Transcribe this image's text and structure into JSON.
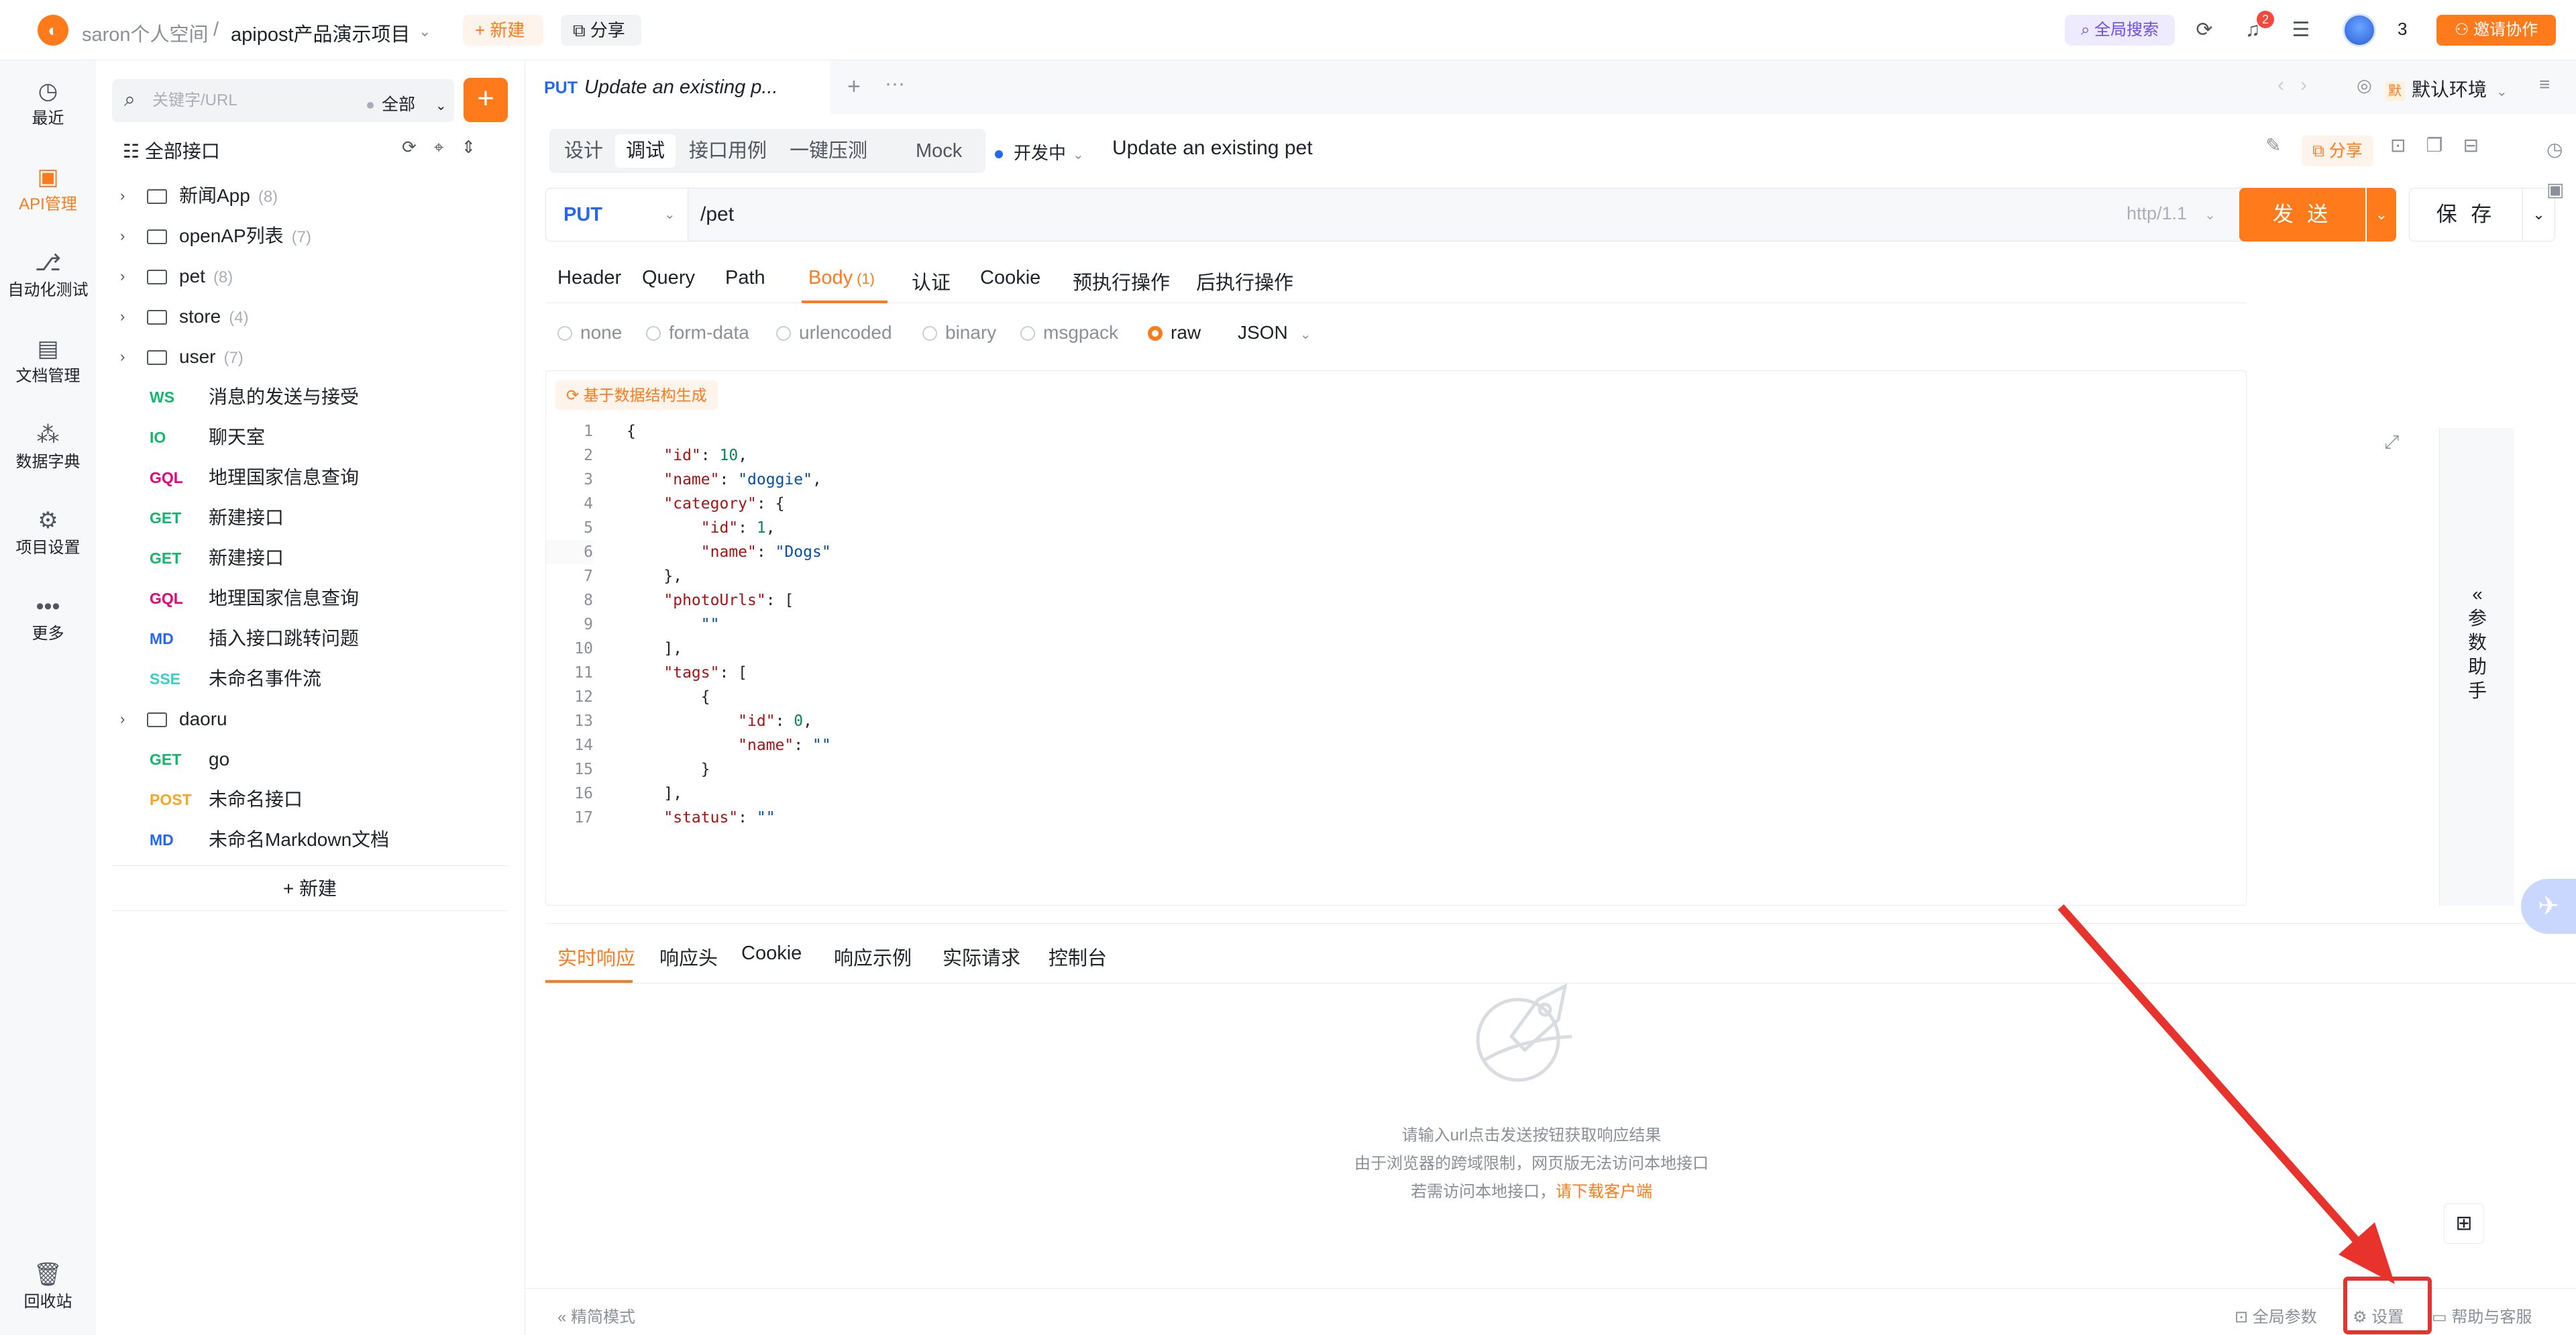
{
  "header": {
    "workspace": "saron个人空间",
    "separator": "/",
    "project": "apipost产品演示项目",
    "new_label": "+ 新建",
    "share_label": "分享",
    "global_search": "全局搜索",
    "notification_count": "2",
    "member_count": "3",
    "invite_label": "邀请协作"
  },
  "rail": {
    "items": [
      {
        "label": "最近",
        "icon": "clock-icon"
      },
      {
        "label": "API管理",
        "icon": "api-icon"
      },
      {
        "label": "自动化测试",
        "icon": "flow-icon"
      },
      {
        "label": "文档管理",
        "icon": "doc-icon"
      },
      {
        "label": "数据字典",
        "icon": "dictionary-icon"
      },
      {
        "label": "项目设置",
        "icon": "settings-icon"
      },
      {
        "label": "更多",
        "icon": "more-icon"
      }
    ],
    "trash": "回收站"
  },
  "tree": {
    "search_placeholder": "关键字/URL",
    "filter": "全部",
    "all_label": "全部接口",
    "rows": [
      {
        "type": "folder",
        "name": "新闻App",
        "count": "(8)"
      },
      {
        "type": "folder",
        "name": "openAP列表",
        "count": "(7)"
      },
      {
        "type": "folder",
        "name": "pet",
        "count": "(8)"
      },
      {
        "type": "folder",
        "name": "store",
        "count": "(4)"
      },
      {
        "type": "folder",
        "name": "user",
        "count": "(7)"
      },
      {
        "type": "api",
        "method": "WS",
        "name": "消息的发送与接受"
      },
      {
        "type": "api",
        "method": "IO",
        "name": "聊天室"
      },
      {
        "type": "api",
        "method": "GQL",
        "name": "地理国家信息查询"
      },
      {
        "type": "api",
        "method": "GET",
        "name": "新建接口"
      },
      {
        "type": "api",
        "method": "GET",
        "name": "新建接口"
      },
      {
        "type": "api",
        "method": "GQL",
        "name": "地理国家信息查询"
      },
      {
        "type": "api",
        "method": "MD",
        "name": "插入接口跳转问题"
      },
      {
        "type": "api",
        "method": "SSE",
        "name": "未命名事件流"
      },
      {
        "type": "folder",
        "name": "daoru",
        "count": ""
      },
      {
        "type": "api",
        "method": "GET",
        "name": "go"
      },
      {
        "type": "api",
        "method": "POST",
        "name": "未命名接口"
      },
      {
        "type": "api",
        "method": "MD",
        "name": "未命名Markdown文档"
      }
    ],
    "new_label": "+  新建"
  },
  "colors": {
    "accent": "#ff7a1a",
    "WS": "#12b76a",
    "IO": "#12b76a",
    "GQL": "#e6007a",
    "GET": "#12b76a",
    "MD": "#2468f2",
    "SSE": "#36cfc9",
    "POST": "#f5a623"
  },
  "main": {
    "tab": {
      "method": "PUT",
      "title": "Update an existing p..."
    },
    "env": "默认环境",
    "mode_tabs": [
      "设计",
      "调试",
      "接口用例",
      "一键压测",
      "Mock"
    ],
    "status": "开发中",
    "api_title": "Update an existing pet",
    "share_label": "分享",
    "method": "PUT",
    "url": "/pet",
    "http_version": "http/1.1",
    "send_label": "发 送",
    "save_label": "保 存",
    "param_tabs": [
      "Header",
      "Query",
      "Path",
      "Body",
      "认证",
      "Cookie",
      "预执行操作",
      "后执行操作"
    ],
    "body_count": "(1)",
    "body_types": [
      "none",
      "form-data",
      "urlencoded",
      "binary",
      "msgpack",
      "raw"
    ],
    "body_format": "JSON",
    "gen_label": "基于数据结构生成",
    "helper_label": "参数助手",
    "response_tabs": [
      "实时响应",
      "响应头",
      "Cookie",
      "响应示例",
      "实际请求",
      "控制台"
    ],
    "empty_line1": "请输入url点击发送按钮获取响应结果",
    "empty_line2": "由于浏览器的跨域限制，网页版无法访问本地接口",
    "empty_line3_prefix": "若需访问本地接口，",
    "empty_line3_link": "请下载客户端"
  },
  "code_lines": [
    "{",
    "    \"id\": 10,",
    "    \"name\": \"doggie\",",
    "    \"category\": {",
    "        \"id\": 1,",
    "        \"name\": \"Dogs\"",
    "    },",
    "    \"photoUrls\": [",
    "        \"\"",
    "    ],",
    "    \"tags\": [",
    "        {",
    "            \"id\": 0,",
    "            \"name\": \"\"",
    "        }",
    "    ],",
    "    \"status\": \"\""
  ],
  "footer": {
    "compact_mode": "精简模式",
    "global_params": "全局参数",
    "settings": "设置",
    "help": "帮助与客服"
  }
}
